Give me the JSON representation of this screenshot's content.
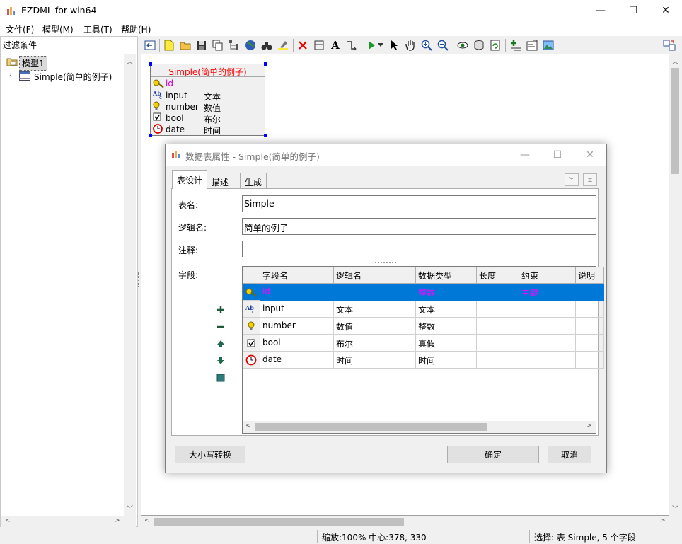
{
  "window": {
    "title": "EZDML for win64",
    "buttons": {
      "minimize": "—",
      "maximize": "☐",
      "close": "✕"
    }
  },
  "menu": {
    "items": [
      "文件(F)",
      "模型(M)",
      "工具(T)",
      "帮助(H)"
    ]
  },
  "left_panel": {
    "filter_label": "过滤条件",
    "tree": {
      "model": "模型1",
      "table": "Simple(简单的例子)"
    }
  },
  "entity": {
    "title": "Simple(简单的例子)",
    "fields": [
      {
        "name": "id",
        "logic": "",
        "icon": "key-icon",
        "color": "#cc00cc"
      },
      {
        "name": "input",
        "logic": "文本",
        "icon": "text-abc-icon",
        "color": "#000000"
      },
      {
        "name": "number",
        "logic": "数值",
        "icon": "bulb-icon",
        "color": "#000000"
      },
      {
        "name": "bool",
        "logic": "布尔",
        "icon": "checkbox-icon",
        "color": "#000000"
      },
      {
        "name": "date",
        "logic": "时间",
        "icon": "clock-icon",
        "color": "#000000"
      }
    ]
  },
  "dialog": {
    "title": "数据表属性 - Simple(简单的例子)",
    "tabs": [
      "表设计",
      "描述",
      "生成"
    ],
    "active_tab": "表设计",
    "labels": {
      "table_name": "表名:",
      "logic_name": "逻辑名:",
      "comment": "注释:",
      "fields": "字段:"
    },
    "values": {
      "table_name": "Simple",
      "logic_name": "简单的例子",
      "comment": ""
    },
    "grid": {
      "headers": [
        "字段名",
        "逻辑名",
        "数据类型",
        "长度",
        "约束",
        "说明"
      ],
      "rows": [
        {
          "icon": "key-icon",
          "name": "id",
          "logic": "",
          "type": "整数",
          "length": "",
          "constraint": "主键",
          "desc": "",
          "selected": true
        },
        {
          "icon": "text-abc-icon",
          "name": "input",
          "logic": "文本",
          "type": "文本",
          "length": "",
          "constraint": "",
          "desc": ""
        },
        {
          "icon": "bulb-icon",
          "name": "number",
          "logic": "数值",
          "type": "整数",
          "length": "",
          "constraint": "",
          "desc": ""
        },
        {
          "icon": "checkbox-icon",
          "name": "bool",
          "logic": "布尔",
          "type": "真假",
          "length": "",
          "constraint": "",
          "desc": ""
        },
        {
          "icon": "clock-icon",
          "name": "date",
          "logic": "时间",
          "type": "时间",
          "length": "",
          "constraint": "",
          "desc": ""
        }
      ]
    },
    "buttons": {
      "case_convert": "大小写转换",
      "ok": "确定",
      "cancel": "取消"
    }
  },
  "status": {
    "zoom": "缩放:100% 中心:378, 330",
    "selection": "选择: 表 Simple, 5 个字段"
  },
  "colors": {
    "selection_bg": "#0078d7",
    "entity_title": "#ff0000",
    "selected_text": "#ff00ff",
    "handle": "#0000ff"
  }
}
